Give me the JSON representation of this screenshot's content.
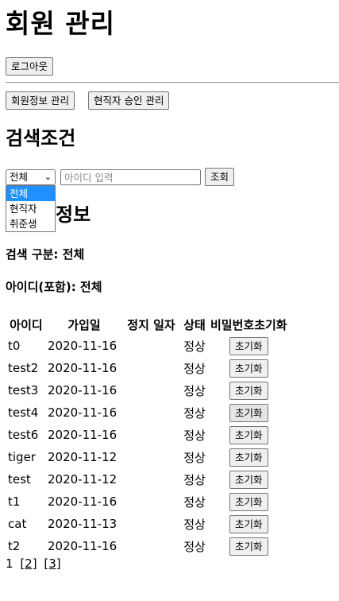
{
  "header": {
    "title": "회원 관리"
  },
  "toolbar": {
    "logout_label": "로그아웃"
  },
  "nav": {
    "member_info_label": "회원정보 관리",
    "employee_approval_label": "현직자 승인 관리"
  },
  "search": {
    "heading": "검색조건",
    "select_value": "전체",
    "options": [
      "전체",
      "현직자",
      "취준생"
    ],
    "id_placeholder": "아이디 입력",
    "submit_label": "조회"
  },
  "results": {
    "heading_visible": "정보",
    "category_label": "검색 구분: 전체",
    "id_label": "아이디(포함): 전체"
  },
  "table": {
    "headers": [
      "아이디",
      "가입일",
      "정지 일자",
      "상태",
      "비밀번호초기화"
    ],
    "rows": [
      {
        "id": "t0",
        "joined": "2020-11-16",
        "suspended": "",
        "status": "정상",
        "action": "초기화"
      },
      {
        "id": "test2",
        "joined": "2020-11-16",
        "suspended": "",
        "status": "정상",
        "action": "초기화"
      },
      {
        "id": "test3",
        "joined": "2020-11-16",
        "suspended": "",
        "status": "정상",
        "action": "초기화"
      },
      {
        "id": "test4",
        "joined": "2020-11-16",
        "suspended": "",
        "status": "정상",
        "action": "초기화"
      },
      {
        "id": "test6",
        "joined": "2020-11-16",
        "suspended": "",
        "status": "정상",
        "action": "초기화"
      },
      {
        "id": "tiger",
        "joined": "2020-11-12",
        "suspended": "",
        "status": "정상",
        "action": "초기화"
      },
      {
        "id": "test",
        "joined": "2020-11-12",
        "suspended": "",
        "status": "정상",
        "action": "초기화"
      },
      {
        "id": "t1",
        "joined": "2020-11-16",
        "suspended": "",
        "status": "정상",
        "action": "초기화"
      },
      {
        "id": "cat",
        "joined": "2020-11-13",
        "suspended": "",
        "status": "정상",
        "action": "초기화"
      },
      {
        "id": "t2",
        "joined": "2020-11-16",
        "suspended": "",
        "status": "정상",
        "action": "초기화"
      }
    ]
  },
  "pagination": {
    "current": "1",
    "pages": [
      "[2]",
      "[3]"
    ]
  }
}
